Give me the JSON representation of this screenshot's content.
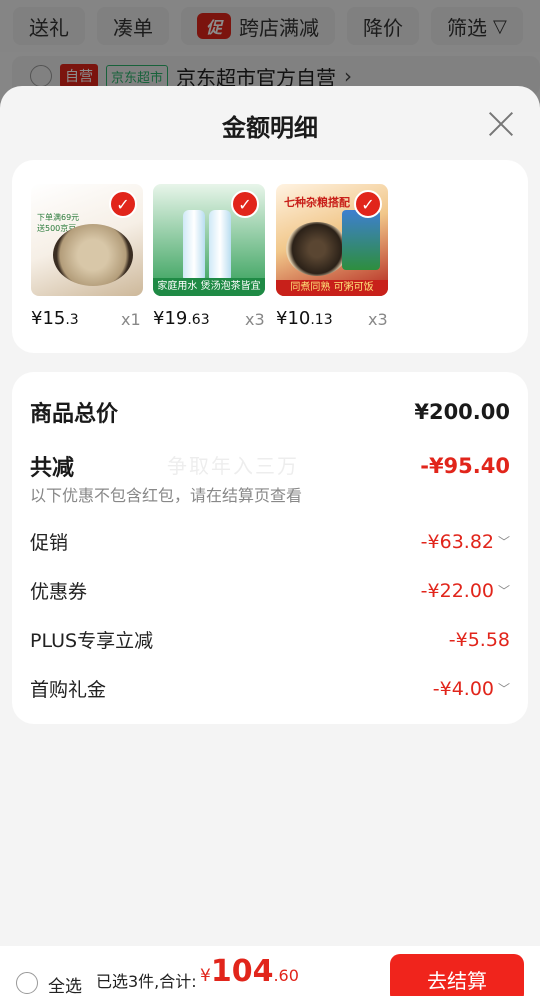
{
  "filter_bar": {
    "chips": [
      "送礼",
      "凑单",
      "跨店满减",
      "降价",
      "筛选"
    ],
    "promo_badge": "促"
  },
  "store": {
    "self_tag": "自营",
    "market_tag": "京东超市",
    "name": "京东超市官方自营",
    "arrow": "›"
  },
  "sheet": {
    "title": "金额明细",
    "products": [
      {
        "price_int": "¥15",
        "price_dec": ".3",
        "qty": "x1",
        "thumb_text": "下单满69元\n送500京豆",
        "badge": "✓"
      },
      {
        "price_int": "¥19",
        "price_dec": ".63",
        "qty": "x3",
        "thumb_text": "家庭用水 煲汤泡茶皆宜",
        "badge": "✓"
      },
      {
        "price_int": "¥10",
        "price_dec": ".13",
        "qty": "x3",
        "thumb_text": "同煮同熟 可粥可饭",
        "thumb_head": "七种杂粮搭配",
        "badge": "✓"
      }
    ],
    "summary": {
      "total_label": "商品总价",
      "total_value": "¥200.00",
      "reduce_label": "共减",
      "reduce_value": "-¥95.40",
      "note": "以下优惠不包含红包，请在结算页查看",
      "watermark": "争取年入三万",
      "items": [
        {
          "label": "促销",
          "value": "-¥63.82",
          "expand": "﹀"
        },
        {
          "label": "优惠券",
          "value": "-¥22.00",
          "expand": "﹀"
        },
        {
          "label": "PLUS专享立减",
          "value": "-¥5.58",
          "expand": ""
        },
        {
          "label": "首购礼金",
          "value": "-¥4.00",
          "expand": "﹀"
        }
      ]
    }
  },
  "bottom_bar": {
    "select_all": "全选",
    "summary": "已选3件,合计:",
    "total_currency": "¥",
    "total_int": "104",
    "total_dec": ".60",
    "checkout": "去结算"
  },
  "colors": {
    "accent": "#e1251b",
    "green": "#2db36c"
  }
}
